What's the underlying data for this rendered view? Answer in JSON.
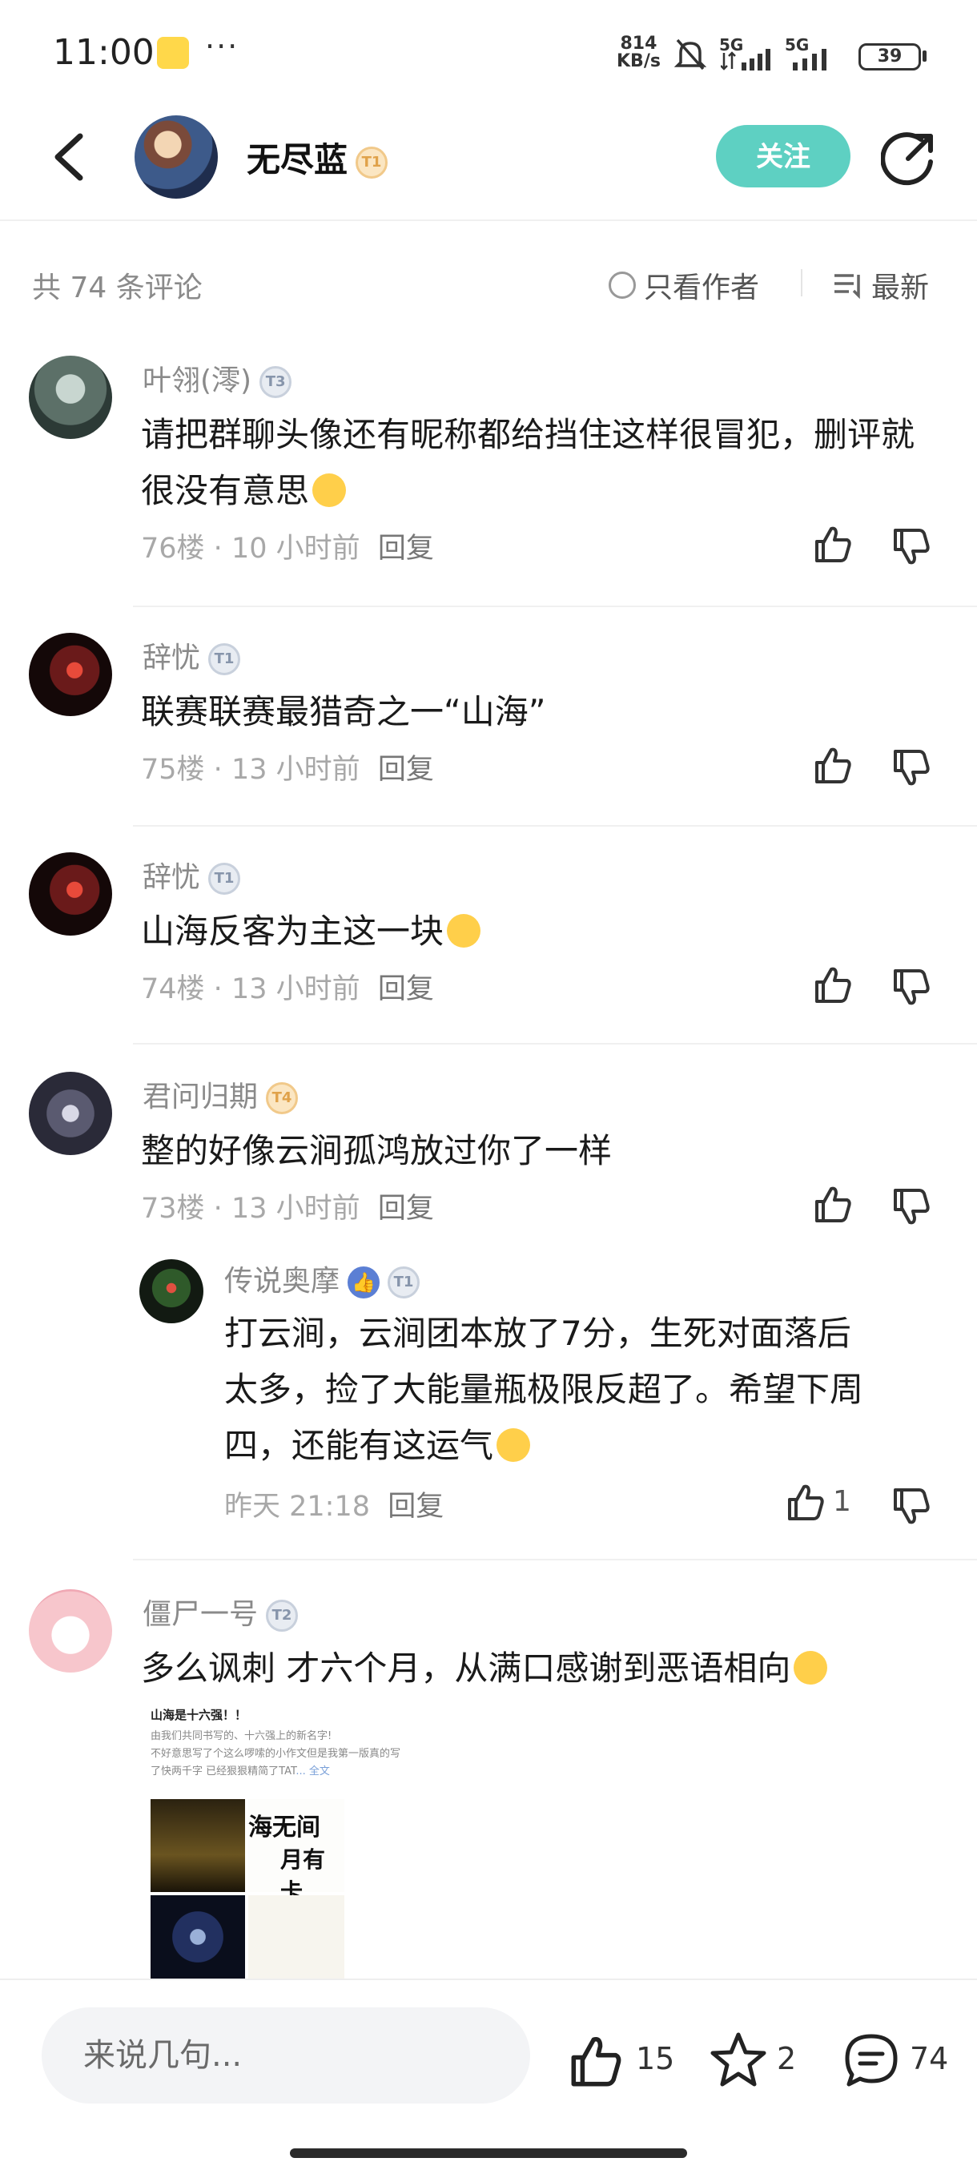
{
  "status_bar": {
    "time": "11:00",
    "dots": "···",
    "speed_top": "814",
    "speed_bottom": "KB/s",
    "signal1": "5G",
    "signal2": "5G",
    "battery": "39"
  },
  "header": {
    "title": "无尽蓝",
    "title_badge": "T1",
    "follow_label": "关注"
  },
  "summary": {
    "count_text": "共 74 条评论",
    "author_only_label": "只看作者",
    "sort_label": "最新"
  },
  "comments": [
    {
      "user": "叶翎(澪)",
      "badge": "T3",
      "text": "请把群聊头像还有昵称都给挡住这样很冒犯，删评就很没有意思",
      "floor": "76楼",
      "time": "10 小时前",
      "reply": "回复"
    },
    {
      "user": "辞忧",
      "badge": "T1",
      "text": "联赛联赛最猎奇之一“山海”",
      "floor": "75楼",
      "time": "13 小时前",
      "reply": "回复"
    },
    {
      "user": "辞忧",
      "badge": "T1",
      "text": "山海反客为主这一块",
      "floor": "74楼",
      "time": "13 小时前",
      "reply": "回复"
    },
    {
      "user": "君问归期",
      "badge": "T4",
      "text": "整的好像云涧孤鸿放过你了一样",
      "floor": "73楼",
      "time": "13 小时前",
      "reply": "回复"
    },
    {
      "user": "僵尸一号",
      "badge": "T2",
      "text": "多么讽刺 才六个月，从满口感谢到恶语相向"
    }
  ],
  "reply": {
    "user": "传说奥摩",
    "badge": "T1",
    "line1": "打云涧，云涧团本放了7分，生死对面落后",
    "line2": "太多，捡了大能量瓶极限反超了。希望下周",
    "line3": "四，还能有这运气",
    "time": "昨天 21:18",
    "reply": "回复",
    "like_count": "1"
  },
  "image_preview": {
    "title": "山海是十六强！！",
    "line1": "由我们共同书写的、十六强上的新名字!",
    "line2": "不好意思写了个这么啰嗦的小作文但是我第一版真的写",
    "line3": "了快两千字 已经狠狠精简了TAT",
    "more": "... 全文",
    "calligraphy1": "海无间",
    "calligraphy2": "月有卡"
  },
  "bottom_bar": {
    "placeholder": "来说几句...",
    "likes": "15",
    "stars": "2",
    "comments": "74"
  },
  "colors": {
    "accent": "#5ed0c2",
    "muted": "#8a8a8a"
  }
}
